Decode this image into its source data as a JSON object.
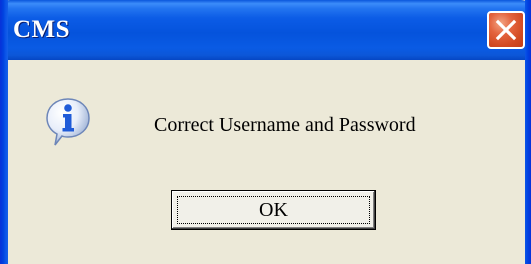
{
  "dialog": {
    "title": "CMS",
    "message": "Correct Username and Password",
    "ok_label": "OK",
    "icon": "info-icon",
    "colors": {
      "titlebar": "#0553dc",
      "close_button": "#e4643e",
      "background": "#ece9d8"
    }
  }
}
